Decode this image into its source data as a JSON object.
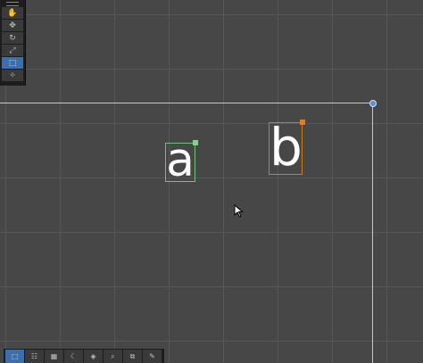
{
  "canvas": {
    "glyphs": [
      {
        "char": "a",
        "selection_color": "#6fc27a"
      },
      {
        "char": "b",
        "selection_color": "#d07a1e"
      }
    ],
    "accent": "#3f6ea8"
  },
  "tool_palette": {
    "items": [
      {
        "icon": "hand-icon",
        "glyph": "✋",
        "active": false
      },
      {
        "icon": "move-icon",
        "glyph": "✥",
        "active": false
      },
      {
        "icon": "rotate-icon",
        "glyph": "↻",
        "active": false
      },
      {
        "icon": "scale-icon",
        "glyph": "⤢",
        "active": false
      },
      {
        "icon": "rect-transform-icon",
        "glyph": "⬚",
        "active": true
      },
      {
        "icon": "pivot-icon",
        "glyph": "✧",
        "active": false
      }
    ]
  },
  "bottom_toolbar": {
    "items": [
      {
        "icon": "rect-select-icon",
        "glyph": "⬚",
        "active": true
      },
      {
        "icon": "align-icon",
        "glyph": "☷",
        "active": false
      },
      {
        "icon": "grid-icon",
        "glyph": "▦",
        "active": false
      },
      {
        "icon": "moon-icon",
        "glyph": "☾",
        "active": false
      },
      {
        "icon": "layers-icon",
        "glyph": "◈",
        "active": false
      },
      {
        "icon": "zoom-icon",
        "glyph": "⌕",
        "active": false
      },
      {
        "icon": "camera-icon",
        "glyph": "⧉",
        "active": false
      },
      {
        "icon": "eyedropper-icon",
        "glyph": "✎",
        "active": false
      }
    ]
  }
}
